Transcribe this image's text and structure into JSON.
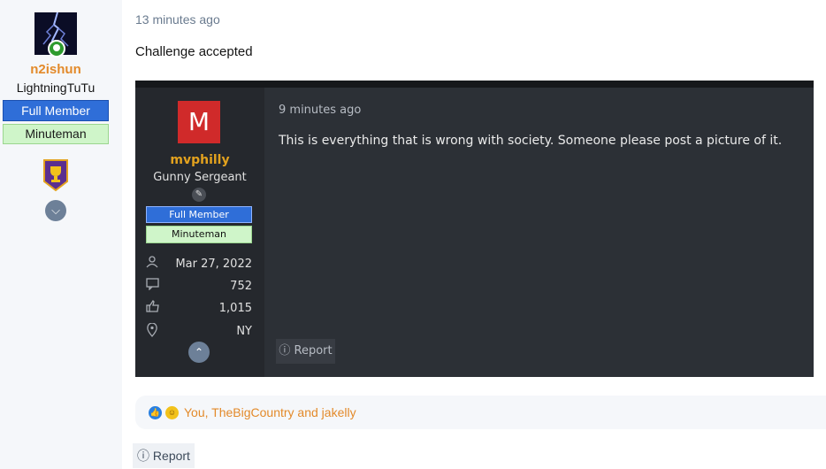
{
  "author": {
    "username": "n2ishun",
    "user_title": "LightningTuTu",
    "banners": [
      "Full Member",
      "Minuteman"
    ],
    "online_status": "online",
    "avatar_icon": "lightning-avatar",
    "trophy_icon": "trophy-icon",
    "expand_icon": "chevron-down-icon"
  },
  "post": {
    "timestamp": "13 minutes ago",
    "message": "Challenge accepted"
  },
  "quoted_post": {
    "avatar_letter": "M",
    "username": "mvphilly",
    "user_title": "Gunny Sergeant",
    "banners": [
      "Full Member",
      "Minuteman"
    ],
    "stats": [
      {
        "icon": "user-icon",
        "value": "Mar 27, 2022"
      },
      {
        "icon": "messages-icon",
        "value": "752"
      },
      {
        "icon": "thumbs-up-icon",
        "value": "1,015"
      },
      {
        "icon": "location-pin-icon",
        "value": "NY"
      }
    ],
    "collapse_icon": "chevron-up-icon",
    "timestamp": "9 minutes ago",
    "message": "This is everything that is wrong with society. Someone please post a picture of it.",
    "report_label": "Report"
  },
  "reactions": {
    "icons": [
      "like-reaction-icon",
      "laugh-reaction-icon"
    ],
    "text": "You, TheBigCountry and jakelly"
  },
  "footer": {
    "report_label": "Report"
  },
  "colors": {
    "username": "#e38a2a",
    "banner_full_member": "#2f6ed8",
    "banner_minuteman": "#cff5c9",
    "quote_background": "#2c3036",
    "quoted_username": "#e3a21e"
  }
}
